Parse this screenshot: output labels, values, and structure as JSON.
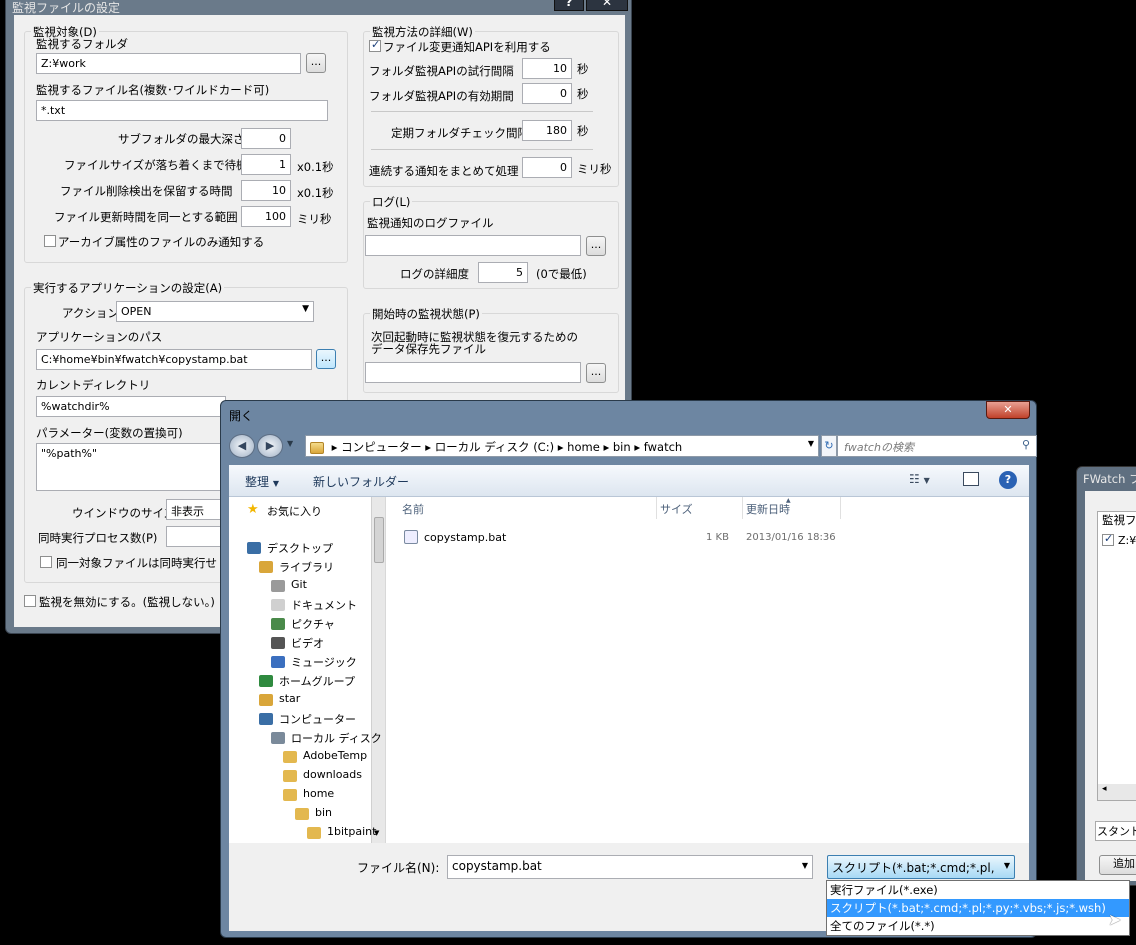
{
  "settings": {
    "title": "監視ファイルの設定",
    "help": "?",
    "close": "✕",
    "target": {
      "legend": "監視対象(D)",
      "folder_label": "監視するフォルダ",
      "folder_value": "Z:¥work",
      "browse": "...",
      "filename_label": "監視するファイル名(複数･ワイルドカード可)",
      "filename_value": "*.txt",
      "depth_label": "サブフォルダの最大深さ",
      "depth_value": "0",
      "settle_label": "ファイルサイズが落ち着くまで待機",
      "settle_value": "1",
      "settle_unit": "x0.1秒",
      "hold_label": "ファイル削除検出を保留する時間",
      "hold_value": "10",
      "hold_unit": "x0.1秒",
      "same_label": "ファイル更新時間を同一とする範囲",
      "same_value": "100",
      "same_unit": "ミリ秒",
      "archive_label": "アーカイブ属性のファイルのみ通知する"
    },
    "method": {
      "legend": "監視方法の詳細(W)",
      "api_label": "ファイル変更通知APIを利用する",
      "retry_label": "フォルダ監視APIの試行間隔",
      "retry_value": "10",
      "retry_unit": "秒",
      "valid_label": "フォルダ監視APIの有効期間",
      "valid_value": "0",
      "valid_unit": "秒",
      "periodic_label": "定期フォルダチェック間隔",
      "periodic_value": "180",
      "periodic_unit": "秒",
      "merge_label": "連続する通知をまとめて処理",
      "merge_value": "0",
      "merge_unit": "ミリ秒"
    },
    "log": {
      "legend": "ログ(L)",
      "file_label": "監視通知のログファイル",
      "file_value": "",
      "browse": "...",
      "level_label": "ログの詳細度",
      "level_value": "5",
      "level_note": "(0で最低)"
    },
    "start": {
      "legend": "開始時の監視状態(P)",
      "desc1": "次回起動時に監視状態を復元するための",
      "desc2": "データ保存先ファイル",
      "browse": "..."
    },
    "app": {
      "legend": "実行するアプリケーションの設定(A)",
      "action_label": "アクション",
      "action_value": "OPEN",
      "path_label": "アプリケーションのパス",
      "path_value": "C:¥home¥bin¥fwatch¥copystamp.bat",
      "browse": "...",
      "cwd_label": "カレントディレクトリ",
      "cwd_value": "%watchdir%",
      "params_label": "パラメーター(変数の置換可)",
      "params_value": "\"%path%\"",
      "window_label": "ウインドウのサイズ",
      "window_value": "非表示",
      "procs_label": "同時実行プロセス数(P)",
      "same_file_label": "同一対象ファイルは同時実行せ"
    },
    "disable_label": "監視を無効にする。(監視しない。)"
  },
  "dialog": {
    "title": "開く",
    "close": "✕",
    "breadcrumb": [
      "コンピューター",
      "ローカル ディスク (C:)",
      "home",
      "bin",
      "fwatch"
    ],
    "search_placeholder": "fwatchの検索",
    "organize": "整理",
    "new_folder": "新しいフォルダー",
    "nav": [
      {
        "label": "お気に入り",
        "icon": "star-icon"
      },
      {
        "label": "デスクトップ",
        "icon": "desktop-icon"
      },
      {
        "label": "ライブラリ",
        "icon": "library-icon"
      },
      {
        "label": "Git",
        "icon": "git-icon"
      },
      {
        "label": "ドキュメント",
        "icon": "document-icon"
      },
      {
        "label": "ピクチャ",
        "icon": "picture-icon"
      },
      {
        "label": "ビデオ",
        "icon": "video-icon"
      },
      {
        "label": "ミュージック",
        "icon": "music-icon"
      },
      {
        "label": "ホームグループ",
        "icon": "homegroup-icon"
      },
      {
        "label": "star",
        "icon": "user-folder-icon"
      },
      {
        "label": "コンピューター",
        "icon": "computer-icon"
      },
      {
        "label": "ローカル ディスク (",
        "icon": "drive-icon"
      },
      {
        "label": "AdobeTemp",
        "icon": "folder-icon"
      },
      {
        "label": "downloads",
        "icon": "folder-icon"
      },
      {
        "label": "home",
        "icon": "folder-icon"
      },
      {
        "label": "bin",
        "icon": "folder-icon"
      },
      {
        "label": "1bitpaint",
        "icon": "folder-icon"
      }
    ],
    "columns": {
      "name": "名前",
      "size": "サイズ",
      "date": "更新日時"
    },
    "files": [
      {
        "name": "copystamp.bat",
        "size": "1 KB",
        "date": "2013/01/16 18:36"
      }
    ],
    "filename_label": "ファイル名(N):",
    "filename_value": "copystamp.bat",
    "filter_value": "スクリプト(*.bat;*.cmd;*.pl,",
    "filter_options": [
      "実行ファイル(*.exe)",
      "スクリプト(*.bat;*.cmd;*.pl;*.py;*.vbs;*.js;*.wsh)",
      "全てのファイル(*.*)"
    ]
  },
  "bg_window": {
    "title": "FWatch フ",
    "group": "監視フ",
    "item": "Z:¥",
    "status": "スタンド",
    "add": "追加"
  }
}
